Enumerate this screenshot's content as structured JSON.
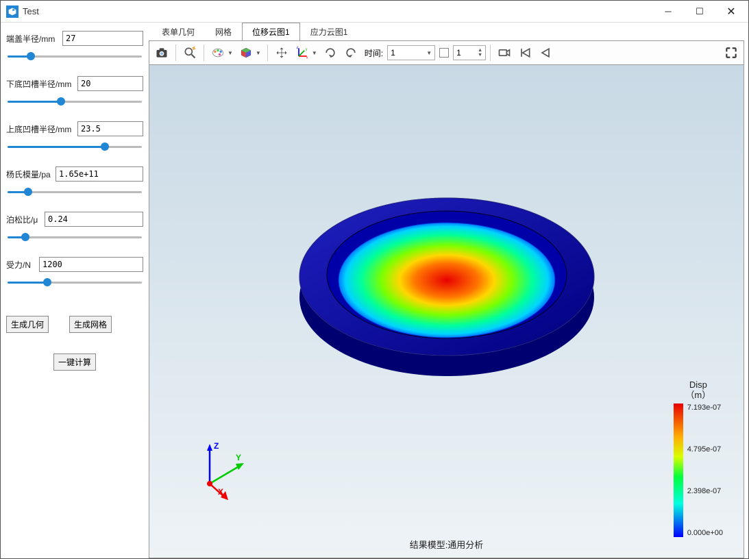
{
  "window": {
    "title": "Test"
  },
  "params": {
    "p1": {
      "label": "端盖半径/mm",
      "value": "27",
      "fill": 18
    },
    "p2": {
      "label": "下底凹槽半径/mm",
      "value": "20",
      "fill": 40
    },
    "p3": {
      "label": "上底凹槽半径/mm",
      "value": "23.5",
      "fill": 72
    },
    "p4": {
      "label": "杨氏模量/pa",
      "value": "1.65e+11",
      "fill": 16
    },
    "p5": {
      "label": "泊松比/μ",
      "value": "0.24",
      "fill": 14
    },
    "p6": {
      "label": "受力/N",
      "value": "1200",
      "fill": 30
    }
  },
  "buttons": {
    "gen_geom": "生成几何",
    "gen_mesh": "生成网格",
    "one_click": "一键计算"
  },
  "tabs": {
    "t1": "表单几何",
    "t2": "网格",
    "t3": "位移云图1",
    "t4": "应力云图1"
  },
  "toolbar": {
    "time_label": "时间:",
    "time_value": "1",
    "frame_value": "1"
  },
  "legend": {
    "title_line1": "Disp",
    "title_line2": "（m）",
    "v0": "7.193e-07",
    "v1": "4.795e-07",
    "v2": "2.398e-07",
    "v3": "0.000e+00"
  },
  "footer": "结果模型:通用分析",
  "axes": {
    "x": "X",
    "y": "Y",
    "z": "Z"
  }
}
